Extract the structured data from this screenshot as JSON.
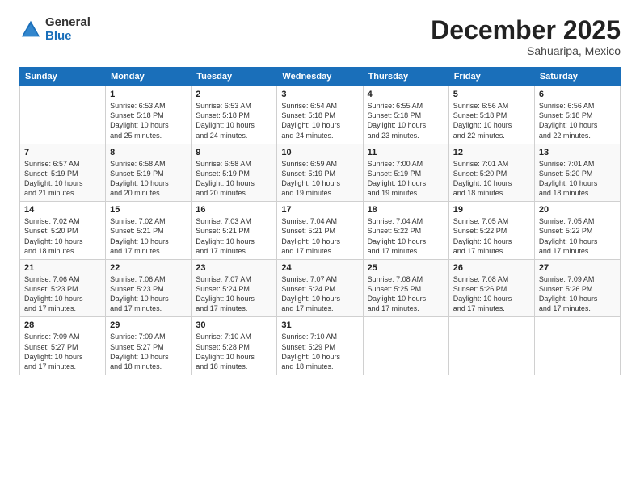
{
  "logo": {
    "general": "General",
    "blue": "Blue"
  },
  "title": "December 2025",
  "subtitle": "Sahuaripa, Mexico",
  "days_of_week": [
    "Sunday",
    "Monday",
    "Tuesday",
    "Wednesday",
    "Thursday",
    "Friday",
    "Saturday"
  ],
  "weeks": [
    [
      {
        "day": "",
        "info": ""
      },
      {
        "day": "1",
        "info": "Sunrise: 6:53 AM\nSunset: 5:18 PM\nDaylight: 10 hours\nand 25 minutes."
      },
      {
        "day": "2",
        "info": "Sunrise: 6:53 AM\nSunset: 5:18 PM\nDaylight: 10 hours\nand 24 minutes."
      },
      {
        "day": "3",
        "info": "Sunrise: 6:54 AM\nSunset: 5:18 PM\nDaylight: 10 hours\nand 24 minutes."
      },
      {
        "day": "4",
        "info": "Sunrise: 6:55 AM\nSunset: 5:18 PM\nDaylight: 10 hours\nand 23 minutes."
      },
      {
        "day": "5",
        "info": "Sunrise: 6:56 AM\nSunset: 5:18 PM\nDaylight: 10 hours\nand 22 minutes."
      },
      {
        "day": "6",
        "info": "Sunrise: 6:56 AM\nSunset: 5:18 PM\nDaylight: 10 hours\nand 22 minutes."
      }
    ],
    [
      {
        "day": "7",
        "info": "Sunrise: 6:57 AM\nSunset: 5:19 PM\nDaylight: 10 hours\nand 21 minutes."
      },
      {
        "day": "8",
        "info": "Sunrise: 6:58 AM\nSunset: 5:19 PM\nDaylight: 10 hours\nand 20 minutes."
      },
      {
        "day": "9",
        "info": "Sunrise: 6:58 AM\nSunset: 5:19 PM\nDaylight: 10 hours\nand 20 minutes."
      },
      {
        "day": "10",
        "info": "Sunrise: 6:59 AM\nSunset: 5:19 PM\nDaylight: 10 hours\nand 19 minutes."
      },
      {
        "day": "11",
        "info": "Sunrise: 7:00 AM\nSunset: 5:19 PM\nDaylight: 10 hours\nand 19 minutes."
      },
      {
        "day": "12",
        "info": "Sunrise: 7:01 AM\nSunset: 5:20 PM\nDaylight: 10 hours\nand 18 minutes."
      },
      {
        "day": "13",
        "info": "Sunrise: 7:01 AM\nSunset: 5:20 PM\nDaylight: 10 hours\nand 18 minutes."
      }
    ],
    [
      {
        "day": "14",
        "info": "Sunrise: 7:02 AM\nSunset: 5:20 PM\nDaylight: 10 hours\nand 18 minutes."
      },
      {
        "day": "15",
        "info": "Sunrise: 7:02 AM\nSunset: 5:21 PM\nDaylight: 10 hours\nand 17 minutes."
      },
      {
        "day": "16",
        "info": "Sunrise: 7:03 AM\nSunset: 5:21 PM\nDaylight: 10 hours\nand 17 minutes."
      },
      {
        "day": "17",
        "info": "Sunrise: 7:04 AM\nSunset: 5:21 PM\nDaylight: 10 hours\nand 17 minutes."
      },
      {
        "day": "18",
        "info": "Sunrise: 7:04 AM\nSunset: 5:22 PM\nDaylight: 10 hours\nand 17 minutes."
      },
      {
        "day": "19",
        "info": "Sunrise: 7:05 AM\nSunset: 5:22 PM\nDaylight: 10 hours\nand 17 minutes."
      },
      {
        "day": "20",
        "info": "Sunrise: 7:05 AM\nSunset: 5:22 PM\nDaylight: 10 hours\nand 17 minutes."
      }
    ],
    [
      {
        "day": "21",
        "info": "Sunrise: 7:06 AM\nSunset: 5:23 PM\nDaylight: 10 hours\nand 17 minutes."
      },
      {
        "day": "22",
        "info": "Sunrise: 7:06 AM\nSunset: 5:23 PM\nDaylight: 10 hours\nand 17 minutes."
      },
      {
        "day": "23",
        "info": "Sunrise: 7:07 AM\nSunset: 5:24 PM\nDaylight: 10 hours\nand 17 minutes."
      },
      {
        "day": "24",
        "info": "Sunrise: 7:07 AM\nSunset: 5:24 PM\nDaylight: 10 hours\nand 17 minutes."
      },
      {
        "day": "25",
        "info": "Sunrise: 7:08 AM\nSunset: 5:25 PM\nDaylight: 10 hours\nand 17 minutes."
      },
      {
        "day": "26",
        "info": "Sunrise: 7:08 AM\nSunset: 5:26 PM\nDaylight: 10 hours\nand 17 minutes."
      },
      {
        "day": "27",
        "info": "Sunrise: 7:09 AM\nSunset: 5:26 PM\nDaylight: 10 hours\nand 17 minutes."
      }
    ],
    [
      {
        "day": "28",
        "info": "Sunrise: 7:09 AM\nSunset: 5:27 PM\nDaylight: 10 hours\nand 17 minutes."
      },
      {
        "day": "29",
        "info": "Sunrise: 7:09 AM\nSunset: 5:27 PM\nDaylight: 10 hours\nand 18 minutes."
      },
      {
        "day": "30",
        "info": "Sunrise: 7:10 AM\nSunset: 5:28 PM\nDaylight: 10 hours\nand 18 minutes."
      },
      {
        "day": "31",
        "info": "Sunrise: 7:10 AM\nSunset: 5:29 PM\nDaylight: 10 hours\nand 18 minutes."
      },
      {
        "day": "",
        "info": ""
      },
      {
        "day": "",
        "info": ""
      },
      {
        "day": "",
        "info": ""
      }
    ]
  ]
}
